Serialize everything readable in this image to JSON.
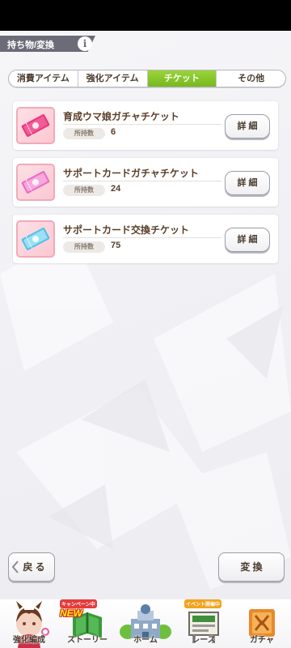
{
  "header": {
    "title": "持ち物/変換",
    "info_icon": "i"
  },
  "tabs": [
    {
      "label": "消費アイテム",
      "active": false
    },
    {
      "label": "強化アイテム",
      "active": false
    },
    {
      "label": "チケット",
      "active": true
    },
    {
      "label": "その他",
      "active": false
    }
  ],
  "items": [
    {
      "name": "育成ウマ娘ガチャチケット",
      "qty_label": "所持数",
      "qty": "6",
      "detail_label": "詳 細",
      "ticket_color": "#e8357c"
    },
    {
      "name": "サポートカードガチャチケット",
      "qty_label": "所持数",
      "qty": "24",
      "detail_label": "詳 細",
      "ticket_color": "#f0a0d6"
    },
    {
      "name": "サポートカード交換チケット",
      "qty_label": "所持数",
      "qty": "75",
      "detail_label": "詳 細",
      "ticket_color": "#8fd8f0"
    }
  ],
  "footer": {
    "back_label": "戻 る",
    "convert_label": "変 換"
  },
  "nav": [
    {
      "label": "強化編成",
      "icon": "character-portrait-icon"
    },
    {
      "label": "ストーリー",
      "icon": "story-book-icon",
      "badge": "キャンペーン中",
      "new": "NEW"
    },
    {
      "label": "ホーム",
      "icon": "home-building-icon"
    },
    {
      "label": "レース",
      "icon": "race-board-icon",
      "badge": "イベント開催中"
    },
    {
      "label": "ガチャ",
      "icon": "gacha-icon"
    }
  ],
  "colors": {
    "active_tab": "#8ccb2d",
    "text_brown": "#5a3d28",
    "title_bar": "#6c6c78"
  }
}
